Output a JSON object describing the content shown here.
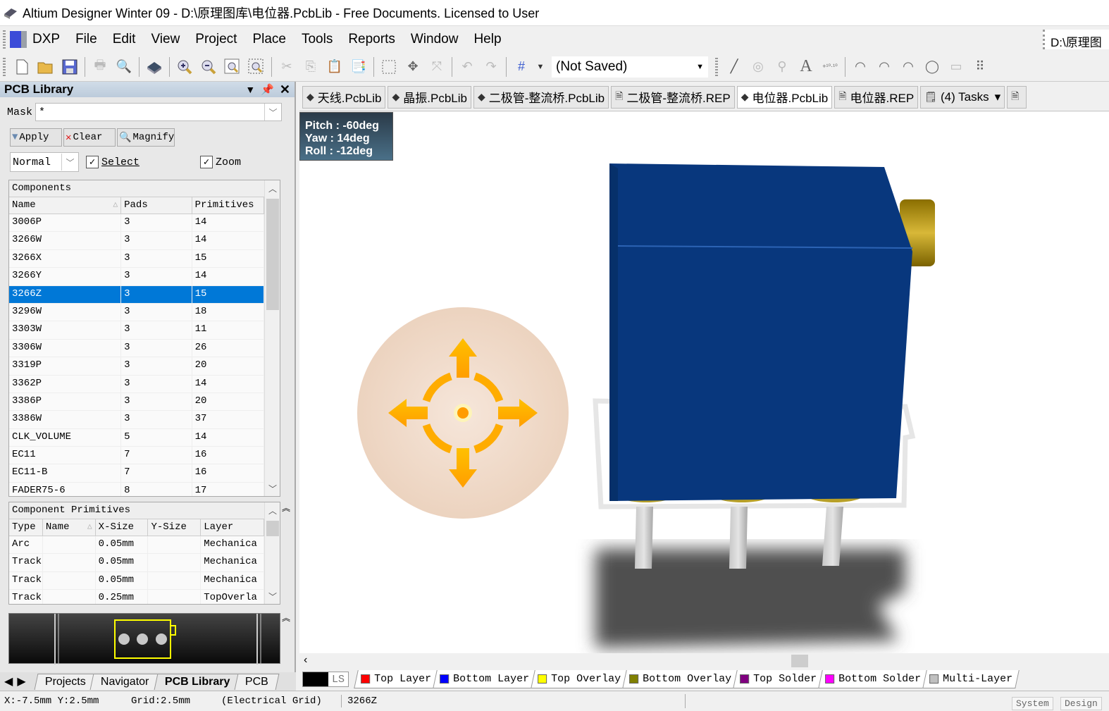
{
  "window": {
    "title": "Altium Designer Winter 09 - D:\\原理图库\\电位器.PcbLib - Free Documents. Licensed to User"
  },
  "menu": {
    "items": [
      {
        "label": "DXP"
      },
      {
        "label": "File"
      },
      {
        "label": "Edit"
      },
      {
        "label": "View"
      },
      {
        "label": "Project"
      },
      {
        "label": "Place"
      },
      {
        "label": "Tools"
      },
      {
        "label": "Reports"
      },
      {
        "label": "Window"
      },
      {
        "label": "Help"
      }
    ],
    "path": "D:\\原理图"
  },
  "toolbar": {
    "icons": [
      "new-icon",
      "open-icon",
      "save-icon",
      "print-icon",
      "print-preview-icon",
      "3d-view-icon",
      "zoom-in-icon",
      "zoom-out-icon",
      "zoom-fit-icon",
      "zoom-area-icon",
      "cut-icon",
      "copy-icon",
      "paste-icon",
      "rubber-stamp-icon",
      "select-area-icon",
      "move-icon",
      "deselect-icon",
      "undo-icon",
      "redo-icon",
      "grid-icon"
    ],
    "doc_select": "(Not Saved)",
    "place_icons": [
      "line-icon",
      "pad-icon",
      "via-icon",
      "string-icon",
      "coordinate-icon",
      "arc-center-icon",
      "arc-edge-icon",
      "arc-any-icon",
      "circle-icon",
      "fill-icon",
      "array-paste-icon"
    ]
  },
  "panel": {
    "title": "PCB Library",
    "mask_label": "Mask",
    "mask_value": "*",
    "apply": "Apply",
    "clear": "Clear",
    "magnify": "Magnify",
    "mode": "Normal",
    "select_label": "Select",
    "select_checked": true,
    "zoom_label": "Zoom",
    "zoom_checked": true,
    "components": {
      "caption": "Components",
      "columns": [
        "Name",
        "Pads",
        "Primitives"
      ],
      "rows": [
        [
          "3006P",
          "3",
          "14"
        ],
        [
          "3266W",
          "3",
          "14"
        ],
        [
          "3266X",
          "3",
          "15"
        ],
        [
          "3266Y",
          "3",
          "14"
        ],
        [
          "3266Z",
          "3",
          "15"
        ],
        [
          "3296W",
          "3",
          "18"
        ],
        [
          "3303W",
          "3",
          "11"
        ],
        [
          "3306W",
          "3",
          "26"
        ],
        [
          "3319P",
          "3",
          "20"
        ],
        [
          "3362P",
          "3",
          "14"
        ],
        [
          "3386P",
          "3",
          "20"
        ],
        [
          "3386W",
          "3",
          "37"
        ],
        [
          "CLK_VOLUME",
          "5",
          "14"
        ],
        [
          "EC11",
          "7",
          "16"
        ],
        [
          "EC11-B",
          "7",
          "16"
        ],
        [
          "FADER75-6",
          "8",
          "17"
        ]
      ],
      "selected": "3266Z"
    },
    "primitives": {
      "caption": "Component Primitives",
      "columns": [
        "Type",
        "Name",
        "X-Size",
        "Y-Size",
        "Layer"
      ],
      "rows": [
        [
          "Arc",
          "",
          "0.05mm",
          "",
          "Mechanica"
        ],
        [
          "Track",
          "",
          "0.05mm",
          "",
          "Mechanica"
        ],
        [
          "Track",
          "",
          "0.05mm",
          "",
          "Mechanica"
        ],
        [
          "Track",
          "",
          "0.25mm",
          "",
          "TopOverla"
        ]
      ]
    },
    "tabs": [
      {
        "label": "Projects"
      },
      {
        "label": "Navigator"
      },
      {
        "label": "PCB Library"
      },
      {
        "label": "PCB"
      }
    ],
    "active_tab": "PCB Library"
  },
  "doc_tabs": [
    {
      "label": "天线.PcbLib",
      "icon": "pcblib-icon"
    },
    {
      "label": "晶振.PcbLib",
      "icon": "pcblib-icon"
    },
    {
      "label": "二极管-整流桥.PcbLib",
      "icon": "pcblib-icon"
    },
    {
      "label": "二极管-整流桥.REP",
      "icon": "report-icon"
    },
    {
      "label": "电位器.PcbLib",
      "icon": "pcblib-icon",
      "active": true
    },
    {
      "label": "电位器.REP",
      "icon": "report-icon"
    },
    {
      "label": "(4) Tasks",
      "icon": "tasks-icon"
    }
  ],
  "viewport": {
    "pitch": "Pitch : -60deg",
    "yaw": "Yaw : 14deg",
    "roll": "Roll : -12deg",
    "body_color": "#08377d",
    "pin_color": "#b8a028"
  },
  "layers": {
    "ls_label": "LS",
    "tabs": [
      {
        "label": "Top Layer",
        "color": "#ff0000"
      },
      {
        "label": "Bottom Layer",
        "color": "#0000ff"
      },
      {
        "label": "Top Overlay",
        "color": "#ffff00"
      },
      {
        "label": "Bottom Overlay",
        "color": "#808000"
      },
      {
        "label": "Top Solder",
        "color": "#800080"
      },
      {
        "label": "Bottom Solder",
        "color": "#ff00ff"
      },
      {
        "label": "Multi-Layer",
        "color": "#c0c0c0"
      }
    ]
  },
  "status": {
    "coords": "X:-7.5mm Y:2.5mm",
    "grid": "Grid:2.5mm",
    "grid_type": "(Electrical Grid)",
    "component": "3266Z",
    "system": "System",
    "design": "Design"
  }
}
